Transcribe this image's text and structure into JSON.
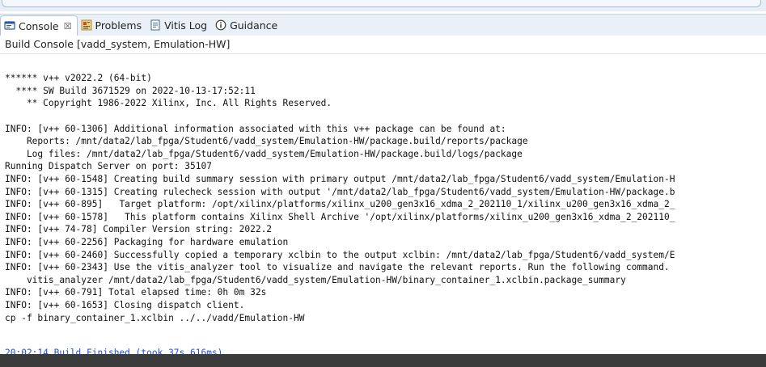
{
  "tabs": [
    {
      "label": "Console",
      "icon": "console-icon",
      "closable": true,
      "close_glyph": "☒"
    },
    {
      "label": "Problems",
      "icon": "problems-icon"
    },
    {
      "label": "Vitis Log",
      "icon": "log-icon"
    },
    {
      "label": "Guidance",
      "icon": "info-icon"
    }
  ],
  "console": {
    "title": "Build Console [vadd_system, Emulation-HW]",
    "lines": [
      "",
      "",
      "****** v++ v2022.2 (64-bit)",
      "  **** SW Build 3671529 on 2022-10-13-17:52:11",
      "    ** Copyright 1986-2022 Xilinx, Inc. All Rights Reserved.",
      "",
      "INFO: [v++ 60-1306] Additional information associated with this v++ package can be found at:",
      "    Reports: /mnt/data2/lab_fpga/Student6/vadd_system/Emulation-HW/package.build/reports/package",
      "    Log files: /mnt/data2/lab_fpga/Student6/vadd_system/Emulation-HW/package.build/logs/package",
      "Running Dispatch Server on port: 35107",
      "INFO: [v++ 60-1548] Creating build summary session with primary output /mnt/data2/lab_fpga/Student6/vadd_system/Emulation-H",
      "INFO: [v++ 60-1315] Creating rulecheck session with output '/mnt/data2/lab_fpga/Student6/vadd_system/Emulation-HW/package.b",
      "INFO: [v++ 60-895]   Target platform: /opt/xilinx/platforms/xilinx_u200_gen3x16_xdma_2_202110_1/xilinx_u200_gen3x16_xdma_2_",
      "INFO: [v++ 60-1578]   This platform contains Xilinx Shell Archive '/opt/xilinx/platforms/xilinx_u200_gen3x16_xdma_2_202110_",
      "INFO: [v++ 74-78] Compiler Version string: 2022.2",
      "INFO: [v++ 60-2256] Packaging for hardware emulation",
      "INFO: [v++ 60-2460] Successfully copied a temporary xclbin to the output xclbin: /mnt/data2/lab_fpga/Student6/vadd_system/E",
      "INFO: [v++ 60-2343] Use the vitis_analyzer tool to visualize and navigate the relevant reports. Run the following command.",
      "    vitis_analyzer /mnt/data2/lab_fpga/Student6/vadd_system/Emulation-HW/binary_container_1.xclbin.package_summary",
      "INFO: [v++ 60-791] Total elapsed time: 0h 0m 32s",
      "INFO: [v++ 60-1653] Closing dispatch client.",
      "cp -f binary_container_1.xclbin ../../vadd/Emulation-HW",
      "",
      "20:02:14 Build Finished (took 37s.616ms)"
    ]
  },
  "colors": {
    "link": "#1f4fd6",
    "bottom_bar": "#3b3b3b"
  }
}
